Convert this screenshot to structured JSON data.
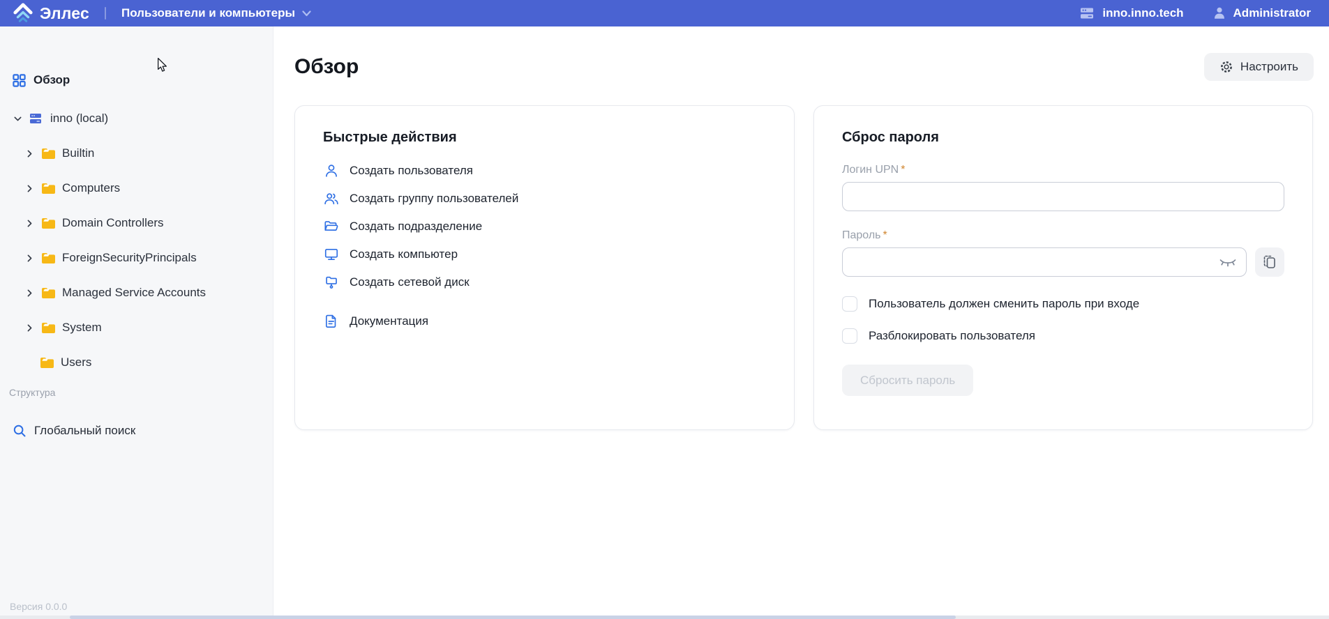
{
  "header": {
    "logo_text": "Эллес",
    "nav_title": "Пользователи и компьютеры",
    "domain": "inno.inno.tech",
    "user": "Administrator"
  },
  "sidebar": {
    "overview_label": "Обзор",
    "tree": [
      {
        "label": "inno (local)",
        "icon": "domain-server-icon",
        "expanded": true
      },
      {
        "label": "Builtin",
        "icon": "folder-icon"
      },
      {
        "label": "Computers",
        "icon": "folder-icon"
      },
      {
        "label": "Domain Controllers",
        "icon": "folder-icon"
      },
      {
        "label": "ForeignSecurityPrincipals",
        "icon": "folder-icon"
      },
      {
        "label": "Managed Service Accounts",
        "icon": "folder-icon"
      },
      {
        "label": "System",
        "icon": "folder-icon"
      },
      {
        "label": "Users",
        "icon": "folder-icon",
        "no_chevron": true
      }
    ],
    "section_label": "Структура",
    "global_search_label": "Глобальный поиск",
    "version": "Версия 0.0.0"
  },
  "main": {
    "title": "Обзор",
    "configure_button": "Настроить",
    "quick_actions": {
      "title": "Быстрые действия",
      "actions": [
        {
          "label": "Создать пользователя",
          "icon": "user-icon"
        },
        {
          "label": "Создать группу пользователей",
          "icon": "user-group-icon"
        },
        {
          "label": "Создать подразделение",
          "icon": "open-folder-icon"
        },
        {
          "label": "Создать компьютер",
          "icon": "computer-icon"
        },
        {
          "label": "Создать сетевой диск",
          "icon": "network-drive-icon"
        }
      ],
      "docs_label": "Документация",
      "docs_icon": "document-icon"
    },
    "password_reset": {
      "title": "Сброс пароля",
      "upn_label": "Логин UPN",
      "required_mark": "*",
      "upn_value": "",
      "password_label": "Пароль",
      "password_value": "",
      "checkbox_change_password": "Пользователь должен сменить пароль при входе",
      "checkbox_unlock_user": "Разблокировать пользователя",
      "submit_label": "Сбросить пароль"
    }
  },
  "colors": {
    "header_bg": "#4a63d2",
    "accent_blue": "#2e6fe4",
    "folder_yellow": "#f7b816",
    "sidebar_bg": "#f6f7f9",
    "required_mark": "#d0852f"
  }
}
